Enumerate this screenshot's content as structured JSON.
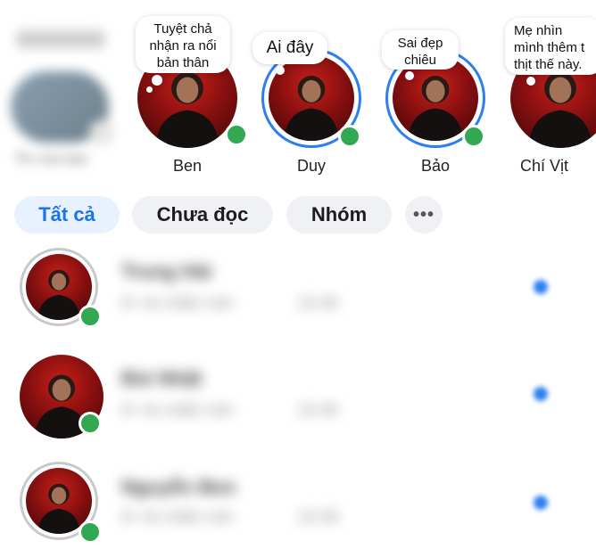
{
  "stories": {
    "own": {
      "label": "Tin của bạn"
    },
    "items": [
      {
        "name": "Ben",
        "note": "Tuyệt chả\nnhận ra nổi\nbản thân",
        "ring": false,
        "online": true
      },
      {
        "name": "Duy",
        "note": "Ai đây",
        "ring": true,
        "online": true
      },
      {
        "name": "Bảo",
        "note": "Sai đẹp\nchiêu",
        "ring": true,
        "online": true
      },
      {
        "name": "Chí Vịt",
        "note": "Mẹ nhìn\nmình thêm t\nthịt thế này.",
        "ring": false,
        "online": true
      }
    ]
  },
  "filters": {
    "all": "Tất cả",
    "unread": "Chưa đọc",
    "groups": "Nhóm",
    "more": "•••"
  },
  "chats": [
    {
      "name": "Trung Hải",
      "preview": "6+ tin nhắn mới",
      "time": "22:40",
      "online": true,
      "unread": true
    },
    {
      "name": "Bùi Nhật",
      "preview": "6+ tin nhắn mới",
      "time": "22:40",
      "online": true,
      "unread": true
    },
    {
      "name": "Nguyễn Ben",
      "preview": "6+ tin nhắn mới",
      "time": "22:39",
      "online": true,
      "unread": true
    }
  ],
  "colors": {
    "accent": "#1a73e8",
    "online": "#32a852",
    "chip_bg": "#f0f1f5"
  }
}
